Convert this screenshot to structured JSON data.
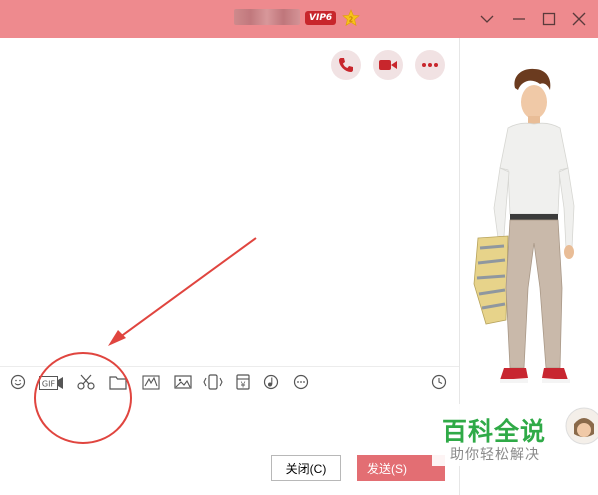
{
  "window": {
    "title_vip": "VIP6",
    "vip_level": "2",
    "controls": [
      "chevron-down-icon",
      "minimize-icon",
      "maximize-icon",
      "close-icon"
    ]
  },
  "header_actions": [
    "phone-icon",
    "video-camera-icon",
    "more-icon"
  ],
  "toolbar": {
    "gif_label": "GIF",
    "tools": [
      "emoji-icon",
      "gif-icon",
      "scissors-icon",
      "folder-icon",
      "doodle-icon",
      "image-icon",
      "shake-icon",
      "red-packet-icon",
      "music-icon",
      "more-icon",
      "clock-icon"
    ],
    "red_packet_symbol": "¥"
  },
  "buttons": {
    "close_label": "关闭(C)",
    "send_label": "发送(S)"
  },
  "watermark": {
    "title": "百科全说",
    "subtitle": "助你轻松解决"
  },
  "colors": {
    "titlebar": "#ee8a8e",
    "accent": "#c8262c",
    "send": "#e36e73",
    "annotation": "#e0453f"
  }
}
